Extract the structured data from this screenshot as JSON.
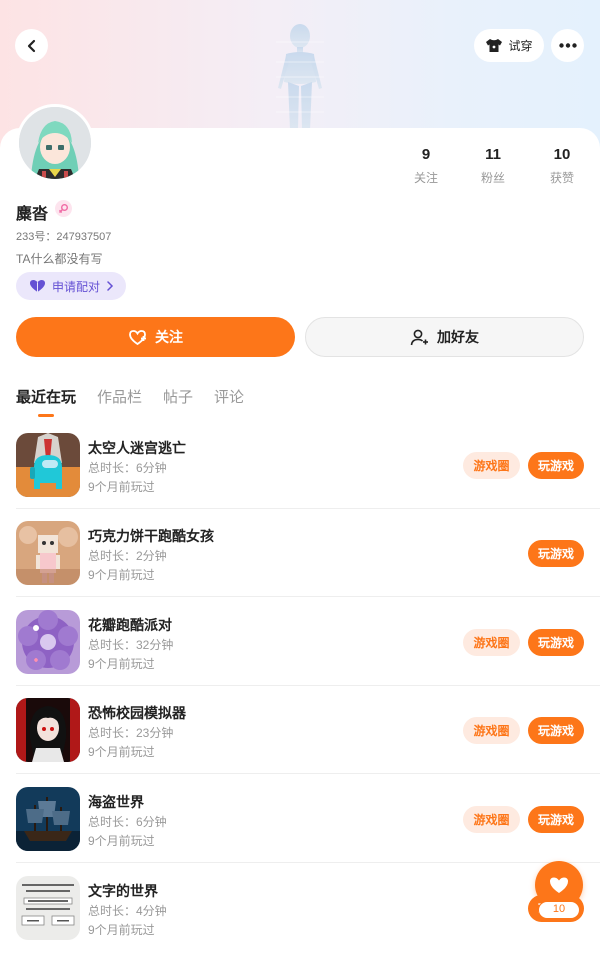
{
  "header": {
    "tryon_label": "试穿"
  },
  "profile": {
    "username": "麋沓",
    "uid_text": "233号：247937507",
    "bio": "TA什么都没有写",
    "pair_label": "申请配对",
    "stats": [
      {
        "value": "9",
        "label": "关注"
      },
      {
        "value": "11",
        "label": "粉丝"
      },
      {
        "value": "10",
        "label": "获赞"
      }
    ]
  },
  "actions": {
    "follow_label": "关注",
    "add_friend_label": "加好友"
  },
  "tabs": [
    {
      "label": "最近在玩",
      "active": true
    },
    {
      "label": "作品栏",
      "active": false
    },
    {
      "label": "帖子",
      "active": false
    },
    {
      "label": "评论",
      "active": false
    }
  ],
  "games": [
    {
      "name": "太空人迷宫逃亡",
      "duration": "总时长：6分钟",
      "last_played": "9个月前玩过",
      "has_circle": true
    },
    {
      "name": "巧克力饼干跑酷女孩",
      "duration": "总时长：2分钟",
      "last_played": "9个月前玩过",
      "has_circle": false
    },
    {
      "name": "花瓣跑酷派对",
      "duration": "总时长：32分钟",
      "last_played": "9个月前玩过",
      "has_circle": true
    },
    {
      "name": "恐怖校园模拟器",
      "duration": "总时长：23分钟",
      "last_played": "9个月前玩过",
      "has_circle": true
    },
    {
      "name": "海盗世界",
      "duration": "总时长：6分钟",
      "last_played": "9个月前玩过",
      "has_circle": true
    },
    {
      "name": "文字的世界",
      "duration": "总时长：4分钟",
      "last_played": "9个月前玩过",
      "has_circle": false
    }
  ],
  "buttons": {
    "game_circle": "游戏圈",
    "play": "玩游戏"
  },
  "like_fab": {
    "count": "10"
  },
  "colors": {
    "accent": "#fd7619",
    "accent_light": "#feeae0",
    "pair_text": "#6551d4",
    "pair_bg": "#ebe7fb"
  },
  "icons": [
    "back-arrow-icon",
    "tshirt-icon",
    "more-dots-icon",
    "female-icon",
    "heart-icon",
    "chevron-right-icon",
    "heart-plus-icon",
    "user-plus-icon"
  ]
}
